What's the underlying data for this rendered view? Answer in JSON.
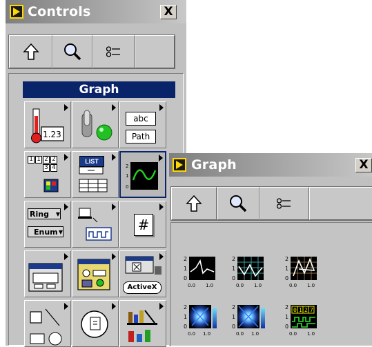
{
  "controls_palette": {
    "title": "Controls",
    "close_label": "X",
    "toolbar": {
      "up_icon": "up-arrow-icon",
      "search_icon": "magnifier-icon",
      "options_icon": "options-icon"
    },
    "category_header": "Graph",
    "items": {
      "numeric": {
        "text": "1.23",
        "icon": "thermometer-numeric-icon"
      },
      "boolean": {
        "icon": "toggle-led-icon"
      },
      "string_path": {
        "string": "abc",
        "path": "Path"
      },
      "array_cluster": {
        "digits": [
          "1",
          "2",
          "3",
          "4"
        ],
        "icon": "array-cluster-icon"
      },
      "list_table": {
        "text": "LIST",
        "icon": "listbox-table-icon"
      },
      "graph": {
        "icon": "graph-waveform-icon"
      },
      "ring_enum": {
        "ring": "Ring",
        "enum": "Enum"
      },
      "io": {
        "icon": "io-waveform-icon"
      },
      "refnum": {
        "text": "#"
      },
      "dialog": {
        "icon": "dialog-window-icon"
      },
      "classic": {
        "icon": "classic-controls-icon"
      },
      "activex": {
        "text": "ActiveX"
      },
      "decorations": {
        "icon": "decorations-icon"
      },
      "select_object": {
        "icon": "select-object-icon"
      },
      "user_controls": {
        "icon": "user-controls-icon"
      }
    }
  },
  "graph_palette": {
    "title": "Graph",
    "close_label": "X",
    "toolbar": {
      "up_icon": "up-arrow-icon",
      "search_icon": "magnifier-icon",
      "options_icon": "options-icon"
    },
    "axis": {
      "y_top": "2",
      "y_mid": "1",
      "y_bot": "0",
      "x_left": "0.0",
      "x_right": "1.0"
    },
    "digital_codes": [
      "0",
      "1",
      "2",
      "7"
    ],
    "items": [
      {
        "name": "waveform-chart-icon"
      },
      {
        "name": "waveform-graph-icon"
      },
      {
        "name": "xy-graph-icon"
      },
      {
        "name": "intensity-chart-icon"
      },
      {
        "name": "intensity-graph-icon"
      },
      {
        "name": "digital-waveform-graph-icon"
      }
    ],
    "colors": {
      "plot_bg": "#000000",
      "trace": "#ffffff",
      "grid": "#3aa0a0",
      "intensity": "#1e7fff"
    }
  }
}
